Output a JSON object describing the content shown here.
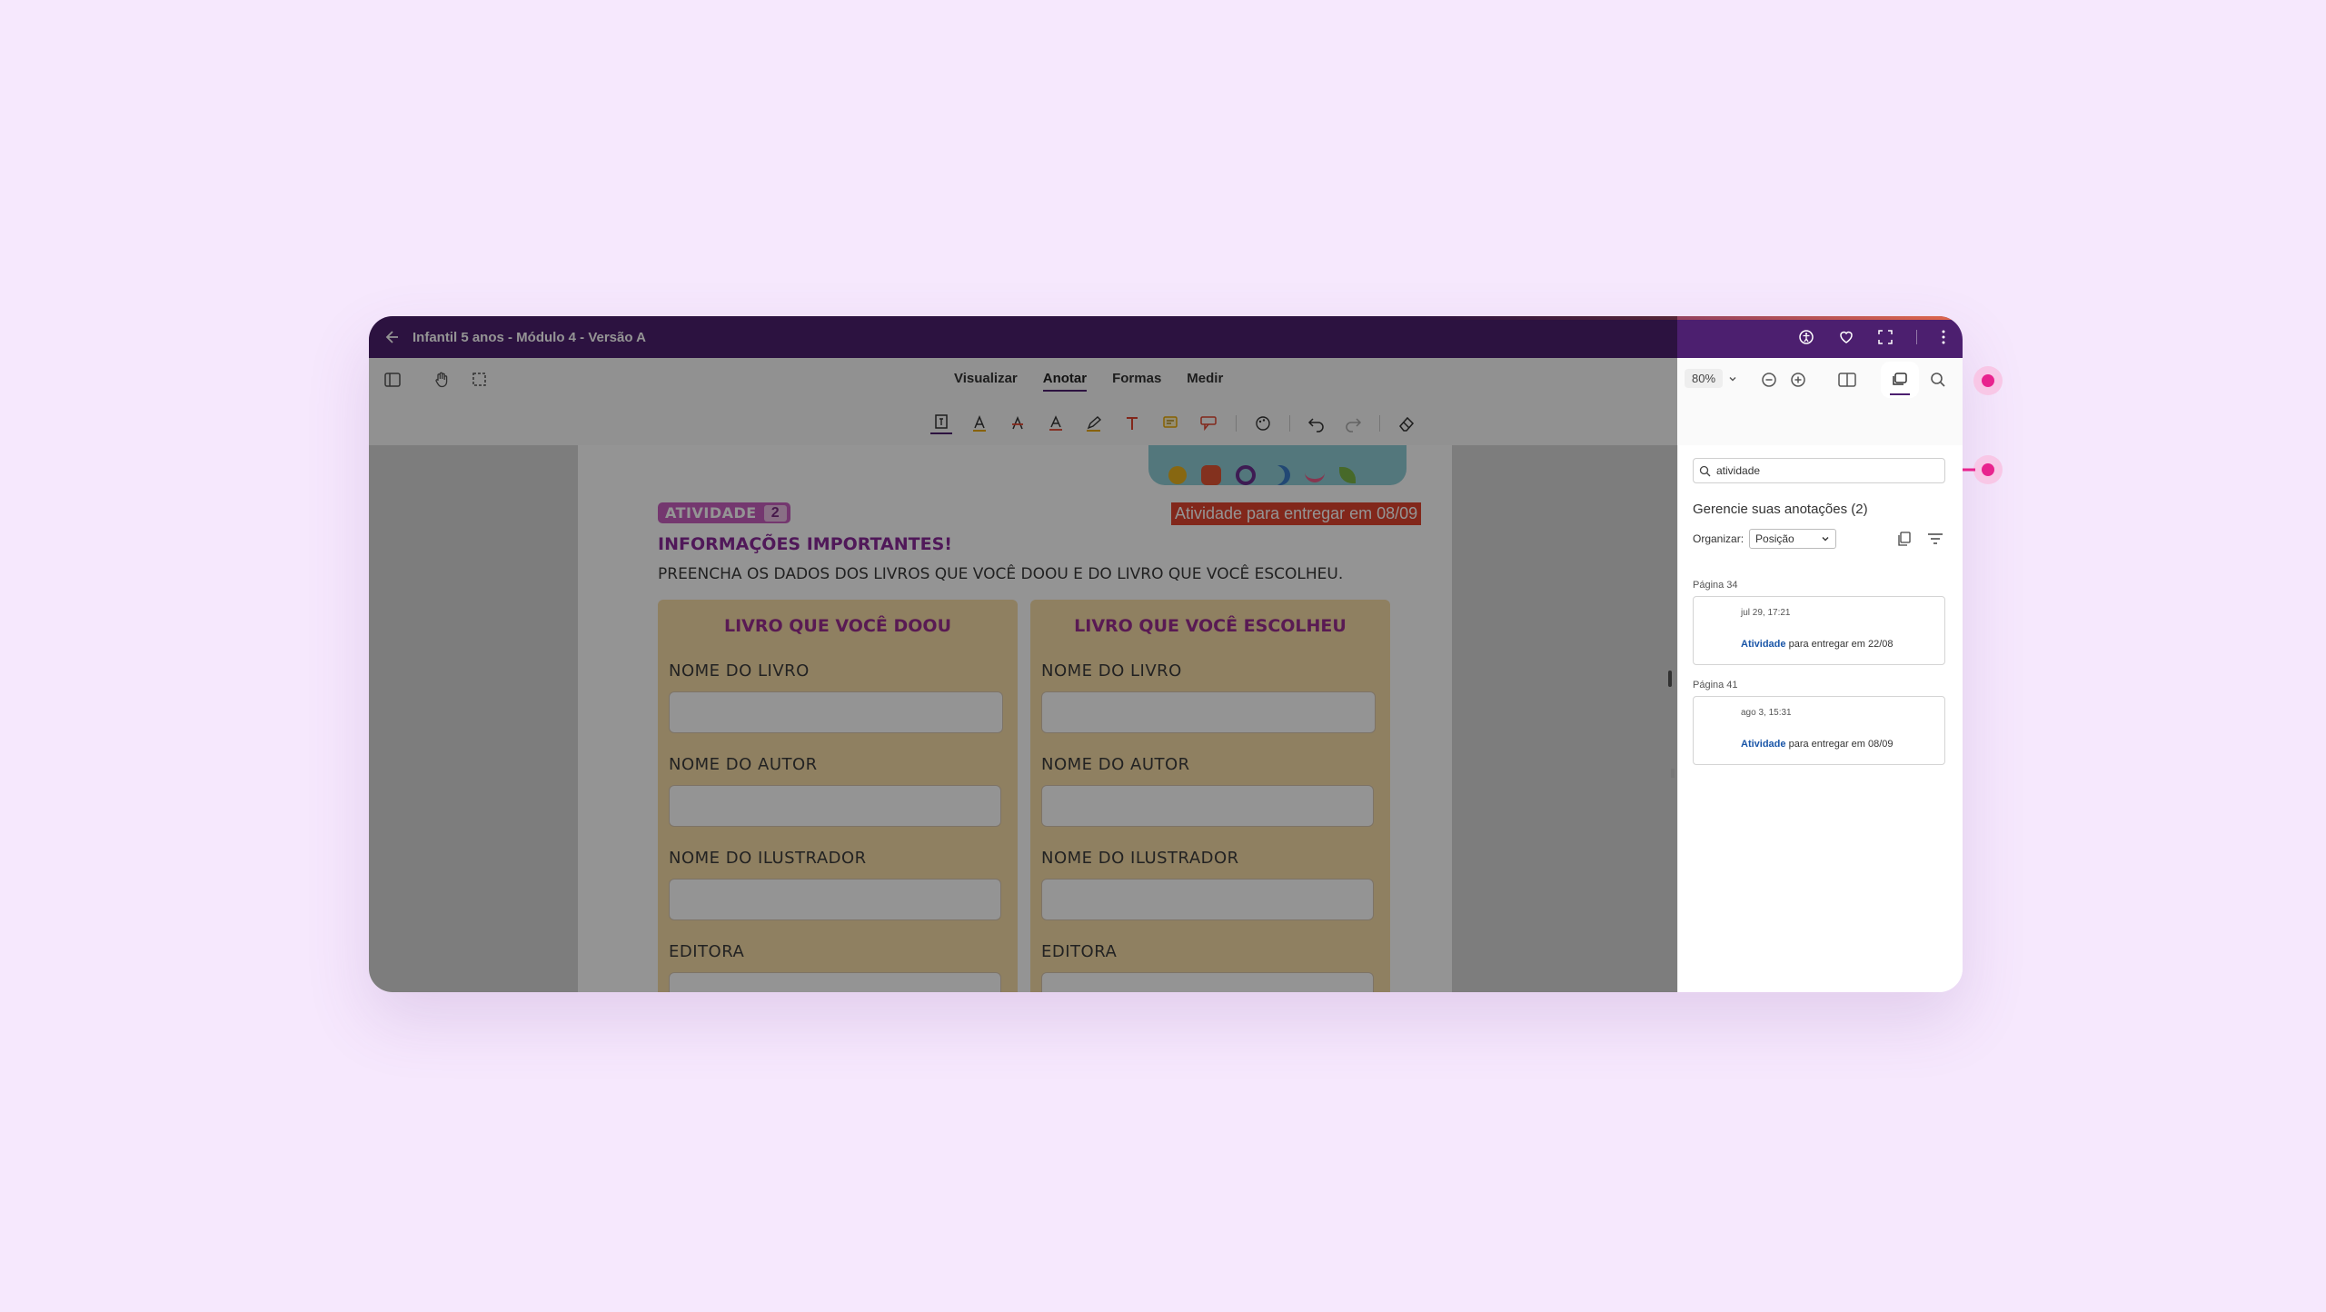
{
  "window": {
    "title": "Infantil 5 anos - Módulo 4 - Versão A",
    "brand_color": "#4c1f6f"
  },
  "toolbar": {
    "tabs": [
      {
        "label": "Visualizar",
        "active": false
      },
      {
        "label": "Anotar",
        "active": true
      },
      {
        "label": "Formas",
        "active": false
      },
      {
        "label": "Medir",
        "active": false
      }
    ],
    "zoom": "80%"
  },
  "document": {
    "badge_label": "ATIVIDADE",
    "badge_number": "2",
    "highlight_text": "Atividade para entregar em 08/09",
    "heading": "INFORMAÇÕES IMPORTANTES!",
    "instruction": "PREENCHA OS DADOS DOS LIVROS QUE VOCÊ DOOU E DO LIVRO QUE VOCÊ ESCOLHEU.",
    "columns": [
      {
        "title": "LIVRO QUE VOCÊ DOOU",
        "fields": [
          "NOME DO LIVRO",
          "NOME DO AUTOR",
          "NOME DO ILUSTRADOR",
          "EDITORA"
        ]
      },
      {
        "title": "LIVRO QUE VOCÊ ESCOLHEU",
        "fields": [
          "NOME DO LIVRO",
          "NOME DO AUTOR",
          "NOME DO ILUSTRADOR",
          "EDITORA"
        ]
      }
    ]
  },
  "sidepanel": {
    "search_value": "atividade",
    "heading": "Gerencie suas anotações (2)",
    "organize_label": "Organizar:",
    "organize_value": "Posição",
    "groups": [
      {
        "page_label": "Página 34",
        "timestamp": "jul 29, 17:21",
        "match": "Atividade",
        "rest": "para entregar em 22/08"
      },
      {
        "page_label": "Página 41",
        "timestamp": "ago 3, 15:31",
        "match": "Atividade",
        "rest": "para entregar em 08/09"
      }
    ]
  },
  "colors": {
    "background": "#f6e8fd",
    "highlight": "#e0442f",
    "heading_purple": "#8a2a9a",
    "pink_marker": "#e8238e"
  }
}
